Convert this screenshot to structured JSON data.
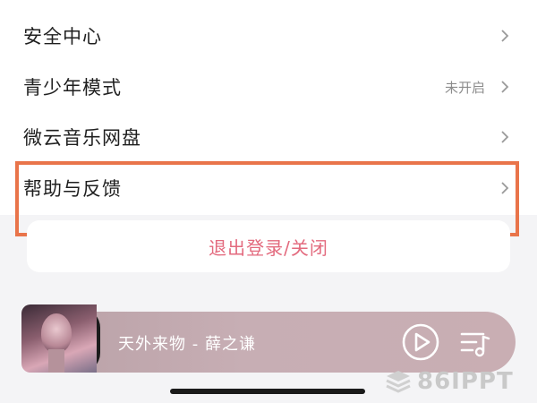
{
  "settings": {
    "items": [
      {
        "label": "安全中心",
        "status": ""
      },
      {
        "label": "青少年模式",
        "status": "未开启"
      },
      {
        "label": "微云音乐网盘",
        "status": ""
      },
      {
        "label": "帮助与反馈",
        "status": ""
      }
    ]
  },
  "logout": {
    "label": "退出登录/关闭"
  },
  "player": {
    "song": "天外来物 - 薛之谦",
    "icons": {
      "play": "play-icon",
      "playlist": "playlist-icon"
    }
  },
  "highlight_color": "#e9744a",
  "accent_color": "#e36a7e",
  "watermark": {
    "text": "86IPPT"
  }
}
